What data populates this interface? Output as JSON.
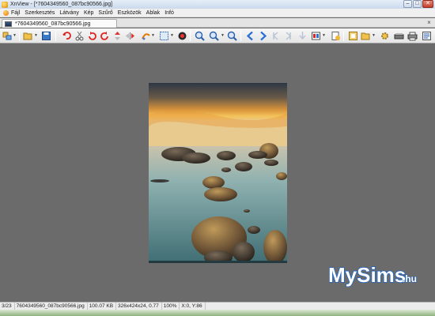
{
  "window": {
    "title": "XnView - [*7604349560_087bc90566.jpg]",
    "minimize_glyph": "–",
    "maximize_glyph": "□",
    "close_glyph": "✕"
  },
  "menu": {
    "items": [
      "Fájl",
      "Szerkesztés",
      "Látvány",
      "Kép",
      "Szűrő",
      "Eszközök",
      "Ablak",
      "Infó"
    ]
  },
  "tab": {
    "label": "*7604349560_087bc90566.jpg",
    "close_glyph": "×"
  },
  "toolbar": {
    "icons": [
      "browse-icon",
      "open-folder-icon",
      "save-icon",
      "undo-icon",
      "cut-icon",
      "rotate-left-icon",
      "rotate-right-icon",
      "flip-vertical-icon",
      "flip-horizontal-icon",
      "adjust-icon",
      "crop-select-icon",
      "color-icon",
      "zoom-in-icon",
      "zoom-icon",
      "zoom-out-icon",
      "previous-icon",
      "next-icon",
      "first-icon",
      "last-icon",
      "slideshow-icon",
      "view-mode-icon",
      "properties-icon",
      "copy-icon",
      "paste-icon",
      "settings-icon",
      "scanner-icon",
      "print-icon"
    ]
  },
  "watermark": {
    "text": "MySims",
    "suffix": ".hu"
  },
  "status": {
    "index": "3/23",
    "filename": "7604349560_087bc90566.jpg",
    "filesize": "100.07 KB",
    "dimensions": "326x424x24, 0.77",
    "zoom": "100%",
    "coords": "X:0, Y:86"
  },
  "colors": {
    "canvas_background": "#6b6b6b",
    "navigation_arrows": "#2a6fd6",
    "watermark_fill": "#ffffff",
    "watermark_outline": "#1b63c8"
  }
}
